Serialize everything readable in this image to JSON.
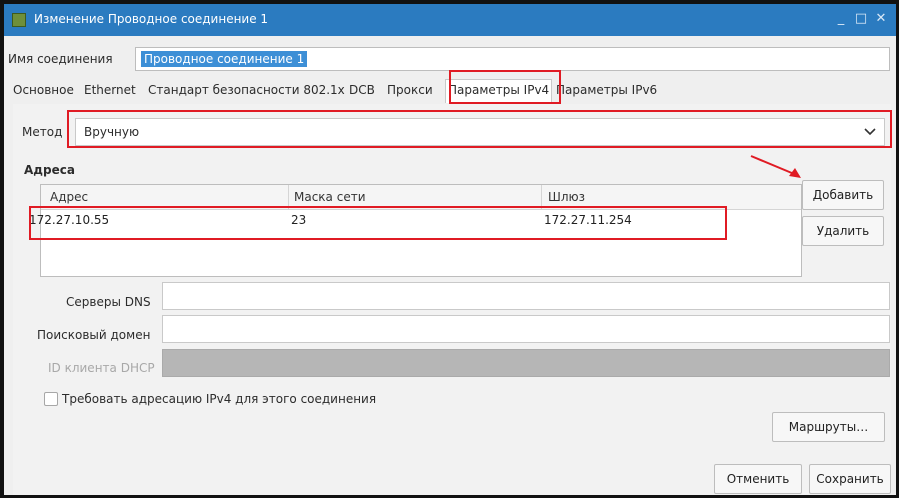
{
  "window": {
    "title": "Изменение Проводное соединение 1",
    "minimize": "_",
    "maximize": "□",
    "close": "✕"
  },
  "connection": {
    "name_label": "Имя соединения",
    "name_value": "Проводное соединение 1"
  },
  "tabs": [
    {
      "label": "Основное"
    },
    {
      "label": "Ethernet"
    },
    {
      "label": "Стандарт безопасности 802.1x"
    },
    {
      "label": "DCB"
    },
    {
      "label": "Прокси"
    },
    {
      "label": "Параметры IPv4",
      "active": true
    },
    {
      "label": "Параметры IPv6"
    }
  ],
  "method": {
    "label": "Метод",
    "value": "Вручную"
  },
  "addresses": {
    "section_title": "Адреса",
    "columns": [
      "Адрес",
      "Маска сети",
      "Шлюз"
    ],
    "rows": [
      [
        "172.27.10.55",
        "23",
        "172.27.11.254"
      ]
    ],
    "add_button": "Добавить",
    "delete_button": "Удалить"
  },
  "dns": {
    "label": "Серверы DNS",
    "value": ""
  },
  "search_domain": {
    "label": "Поисковый домен",
    "value": ""
  },
  "dhcp_client_id": {
    "label": "ID клиента DHCP",
    "value": ""
  },
  "require_ipv4": {
    "label": "Требовать адресацию IPv4 для этого соединения",
    "checked": false
  },
  "routes_button": "Маршруты…",
  "footer": {
    "cancel": "Отменить",
    "save": "Сохранить"
  },
  "colors": {
    "titlebar": "#2b7bc0",
    "annotation": "#e01b24",
    "selection": "#3d8fd6"
  }
}
